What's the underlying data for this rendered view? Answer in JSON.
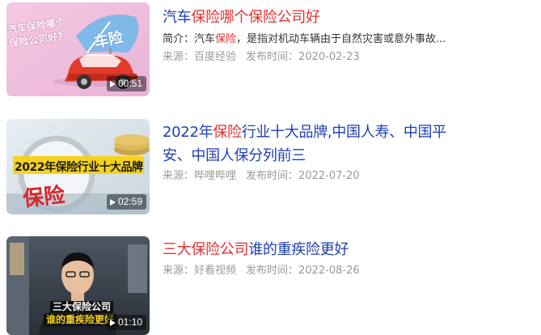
{
  "results": [
    {
      "title_prefix": "汽车",
      "title_highlight": "保险哪个保险公司好",
      "title_suffix": "",
      "abstract_prefix": "简介：汽车",
      "abstract_highlight": "保险",
      "abstract_suffix": "，是指对机动车辆由于自然灾害或意外事故...",
      "source_label": "来源：",
      "source": "百度经验",
      "time_label": "发布时间：",
      "date": "2020-02-23",
      "duration": "00:51",
      "thumb_text_line1": "汽车保险哪个",
      "thumb_text_line2": "保险公司好?",
      "thumb_sign": "车险"
    },
    {
      "title_prefix": "2022年",
      "title_highlight": "保险",
      "title_suffix_line1": "行业十大品牌,中国人寿、中国平",
      "title_suffix_line2": "安、中国人保分列前三",
      "source_label": "来源：",
      "source": "哔哩哔哩",
      "time_label": "发布时间：",
      "date": "2022-07-20",
      "duration": "02:59",
      "thumb_banner": "2022年保险行业十大品牌",
      "thumb_glass_text": "保险"
    },
    {
      "title_prefix": "",
      "title_highlight": "三大保险公司",
      "title_suffix": "谁的重疾险更好",
      "source_label": "来源：",
      "source": "好看视频",
      "time_label": "发布时间：",
      "date": "2022-08-26",
      "duration": "01:10",
      "thumb_caption_line1": "三大保险公司",
      "thumb_caption_line2": "谁的重疾险更好"
    }
  ],
  "colors": {
    "title": "#1f3fb0",
    "highlight": "#e0322f",
    "meta": "#999999",
    "text": "#333333"
  },
  "icons": [
    "play-icon"
  ]
}
